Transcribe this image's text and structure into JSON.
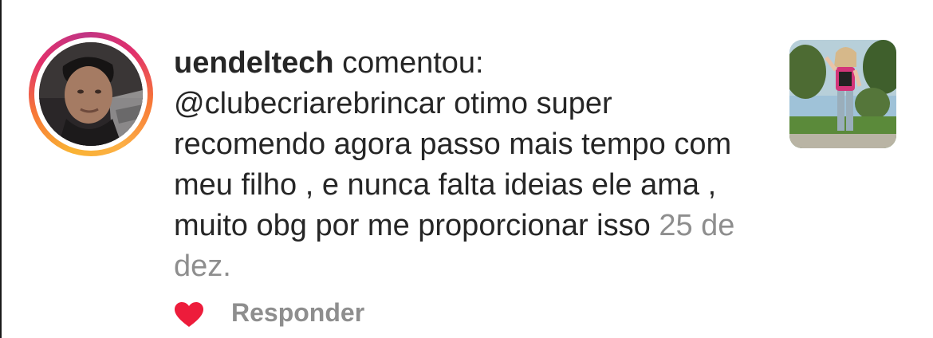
{
  "comment": {
    "username": "uendeltech",
    "action": "comentou:",
    "text": "@clubecriarebrincar  otimo super recomendo agora passo mais tempo com meu filho , e nunca falta ideias ele ama , muito obg  por me proporcionar isso",
    "date": "25 de dez."
  },
  "actions": {
    "like_icon": "heart-icon",
    "like_color": "#ed1c3b",
    "reply_label": "Responder"
  },
  "colors": {
    "text": "#262626",
    "muted": "#8e8e8e",
    "ring": [
      "#fcaf45",
      "#f77737",
      "#e1306c",
      "#c13584"
    ]
  }
}
